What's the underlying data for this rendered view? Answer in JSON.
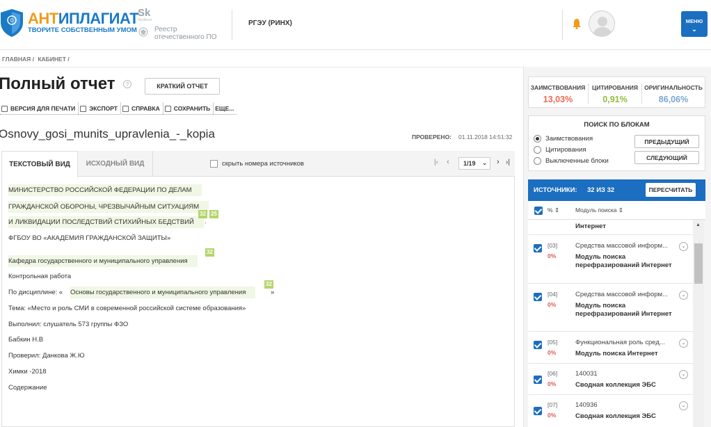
{
  "header": {
    "brand_main": "АНТИПЛАГИАТ",
    "brand_tagline": "ТВОРИТЕ СОБСТВЕННЫМ УМОМ",
    "sk_logo": "Sk",
    "sk_sub": "Skolkovo",
    "registry": "Реестр отечественного ПО",
    "organization": "РГЭУ (РИНХ)",
    "menu_label": "МЕНЮ"
  },
  "breadcrumb": [
    "ГЛАВНАЯ /",
    "КАБИНЕТ /"
  ],
  "report": {
    "title": "Полный отчет",
    "short_report_btn": "КРАТКИЙ ОТЧЕТ",
    "toolbar": [
      "ВЕРСИЯ ДЛЯ ПЕЧАТИ",
      "ЭКСПОРТ",
      "СПРАВКА",
      "СОХРАНИТЬ",
      "ЕЩЕ..."
    ],
    "file_name": "Osnovy_gosi_munits_upravlenia_-_kopia",
    "checked_label": "ПРОВЕРЕНО:",
    "checked_value": "01.11.2018 14:51:32"
  },
  "viewer": {
    "tab_text": "ТЕКСТОВЫЙ ВИД",
    "tab_source": "ИСХОДНЫЙ ВИД",
    "hide_numbers_label": "скрыть номера источников",
    "page_value": "1/19",
    "lines": [
      {
        "text": "МИНИСТЕРСТВО РОССИЙСКОЙ ФЕДЕРАЦИИ ПО ДЕЛАМ",
        "hl": true
      },
      {
        "text": "ГРАЖДАНСКОЙ ОБОРОНЫ, ЧРЕЗВЫЧАЙНЫМ СИТУАЦИЯМ",
        "hl": true
      },
      {
        "text": "И ЛИКВИДАЦИИ ПОСЛЕДСТВИЙ СТИХИЙНЫХ БЕДСТВИЙ",
        "hl": true
      },
      {
        "text": "ФГБОУ ВО «АКАДЕМИЯ ГРАЖДАНСКОЙ ЗАЩИТЫ»",
        "hl": false
      },
      {
        "text": "Кафедра государственного и муниципального управления",
        "hl": true
      },
      {
        "text": "Контрольная работа",
        "hl": false
      },
      {
        "text": "По дисциплине: «",
        "hl": false
      },
      {
        "text": "Основы государственного и муниципального управления",
        "hl": true
      },
      {
        "text": "»",
        "hl": false
      },
      {
        "text": "Тема: «Место и роль СМИ в современной российской системе образования»",
        "hl": false
      },
      {
        "text": "Выполнил: слушатель 573 группы ФЗО",
        "hl": false
      },
      {
        "text": "Бабкин Н.В",
        "hl": false
      },
      {
        "text": "Проверил: Данкова Ж.Ю",
        "hl": false
      },
      {
        "text": "Химки -2018",
        "hl": false
      },
      {
        "text": "Содержание",
        "hl": false
      }
    ],
    "tags": [
      "32",
      "25",
      "32",
      "32"
    ],
    "dot": "."
  },
  "stats": {
    "borrow_label": "ЗАИМСТВОВАНИЯ",
    "borrow_value": "13,03%",
    "cite_label": "ЦИТИРОВАНИЯ",
    "cite_value": "0,91%",
    "orig_label": "ОРИГИНАЛЬНОСТЬ",
    "orig_value": "86,06%",
    "colors": {
      "borrow": "#ef6a50",
      "cite": "#8cbf3f",
      "orig": "#7aa6d4"
    }
  },
  "blocks": {
    "title": "ПОИСК ПО БЛОКАМ",
    "options": [
      "Заимствования",
      "Цитирования",
      "Выключенные блоки"
    ],
    "prev_btn": "ПРЕДЫДУЩИЙ",
    "next_btn": "СЛЕДУЮЩИЙ"
  },
  "sources": {
    "title": "ИСТОЧНИКИ:",
    "count": "32 ИЗ 32",
    "recalc_btn": "ПЕРЕСЧИТАТЬ",
    "col_pct": "%",
    "col_module": "Модуль поиска",
    "partial_module": "Интернет",
    "items": [
      {
        "num": "[03]",
        "pct": "0%",
        "name": "Средства массовой информ...",
        "module": "Модуль поиска перефразирований Интернет"
      },
      {
        "num": "[04]",
        "pct": "0%",
        "name": "Средства массовой информ...",
        "module": "Модуль поиска перефразирований Интернет"
      },
      {
        "num": "[05]",
        "pct": "0%",
        "name": "Функциональная роль сред...",
        "module": "Модуль поиска Интернет"
      },
      {
        "num": "[06]",
        "pct": "0%",
        "name": "140031",
        "module": "Сводная коллекция ЭБС"
      },
      {
        "num": "[07]",
        "pct": "0%",
        "name": "140936",
        "module": "Сводная коллекция ЭБС"
      }
    ]
  }
}
